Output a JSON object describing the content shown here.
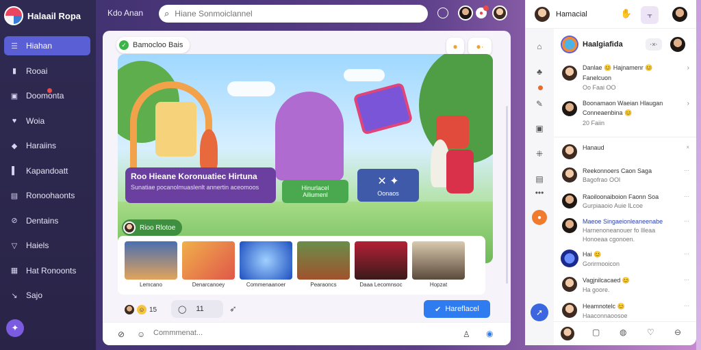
{
  "brand": {
    "name": "Halaail Ropa"
  },
  "sidebar": {
    "items": [
      {
        "label": "Hiahan",
        "icon": "menu-icon",
        "active": true
      },
      {
        "label": "Rooai",
        "icon": "bookmark-icon"
      },
      {
        "label": "Doomonta",
        "icon": "chat-icon",
        "badge": true
      },
      {
        "label": "Woia",
        "icon": "heart-icon"
      },
      {
        "label": "Haraiins",
        "icon": "tag-icon"
      },
      {
        "label": "Kapandoatt",
        "icon": "bookmark-icon"
      },
      {
        "label": "Ronoohaonts",
        "icon": "list-icon"
      },
      {
        "label": "Dentains",
        "icon": "link-icon"
      },
      {
        "label": "Haiels",
        "icon": "filter-icon"
      },
      {
        "label": "Hat Ronoonts",
        "icon": "grid-icon"
      },
      {
        "label": "Sajo",
        "icon": "settings-icon"
      }
    ]
  },
  "topbar": {
    "title": "Kdo Anan",
    "search": {
      "placeholder": "Hiane Sonmoiclannel"
    }
  },
  "post": {
    "tag": "Bamocloo Bais",
    "banner": {
      "title": "Roo Hieane Koronuatiec Hirtuna",
      "subtitle": "Sunatiae pocanolmuaslenlt annertin aceomoos"
    },
    "green_button": {
      "line1": "Hinurlacel",
      "line2": "Ailiumenl"
    },
    "blue_button": {
      "label": "Oonaos"
    },
    "footer_tag": "Rioo Rlotoe",
    "thumbnails": [
      {
        "caption": "Lemcano"
      },
      {
        "caption": "Denarcanoey"
      },
      {
        "caption": "Commenaanoer"
      },
      {
        "caption": "Pearaoncs"
      },
      {
        "caption": "Daaa Lecomnsoc"
      },
      {
        "caption": "Hopzat"
      }
    ],
    "reactions_count": "15",
    "comment_count": "11",
    "primary_button": "Hareflacel",
    "comment_placeholder": "Commmenat..."
  },
  "rpanel": {
    "header_name": "Hamacial",
    "group": {
      "title": "Haalgiafida",
      "close_label": "·×·",
      "cards": [
        {
          "line1": "Danlae 😊 Hajnamenr 😊",
          "line2": "Fanelcuon",
          "meta": "Oo Faai OO"
        },
        {
          "line1": "Boonamaon Waeian Hlaugan",
          "line2": "Conneaenbina 😊",
          "meta": "20 Faiin"
        }
      ]
    },
    "list": [
      {
        "name": "Hanaud",
        "sub": "",
        "more": "×"
      },
      {
        "name": "Reekonnoers Caon Saga",
        "sub": "Bagofrao OOl",
        "more": "···"
      },
      {
        "name": "Raoiloonaiboion Faonn Soa",
        "sub": "Gurpiaaoio Auie lLcoe",
        "more": "···"
      },
      {
        "name": "Maeoe Singaeionleaneenabe",
        "sub": "Harnenoneanouer fo llleaa",
        "sub2": "Honoeaa cgonoen.",
        "more": "···",
        "highlight": true
      },
      {
        "name": "Hai 😊",
        "sub": "Gorirmooicon",
        "more": "···"
      },
      {
        "name": "Vagjnilcacaed 😊",
        "sub": "Ha goore.",
        "more": "···"
      },
      {
        "name": "Heamnotelc 😊",
        "sub": "Haaconnaoosoe",
        "more": "···"
      }
    ]
  }
}
